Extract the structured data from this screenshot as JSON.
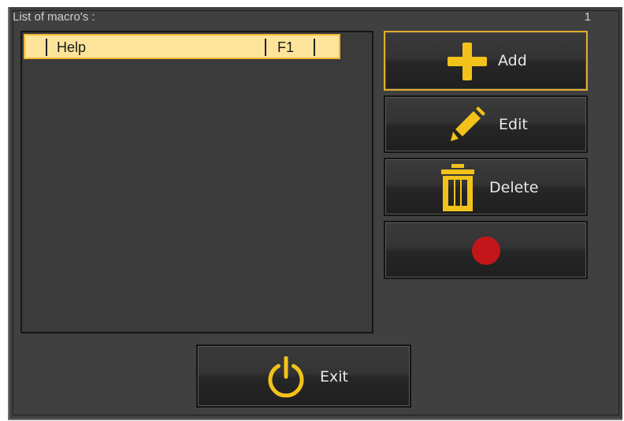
{
  "header": {
    "label": "List of macro's :",
    "count": "1"
  },
  "macros": [
    {
      "name": "Help",
      "key": "F1"
    }
  ],
  "buttons": {
    "add": {
      "label": "Add",
      "icon": "plus-icon"
    },
    "edit": {
      "label": "Edit",
      "icon": "pencil-icon"
    },
    "delete": {
      "label": "Delete",
      "icon": "trash-icon"
    },
    "record": {
      "label": "",
      "icon": "record-icon"
    },
    "exit": {
      "label": "Exit",
      "icon": "power-icon"
    }
  },
  "colors": {
    "accent": "#f2c21b",
    "record": "#c2161b",
    "selection_fill": "#fde49a",
    "selection_border": "#f2b531",
    "panel": "#404040"
  }
}
